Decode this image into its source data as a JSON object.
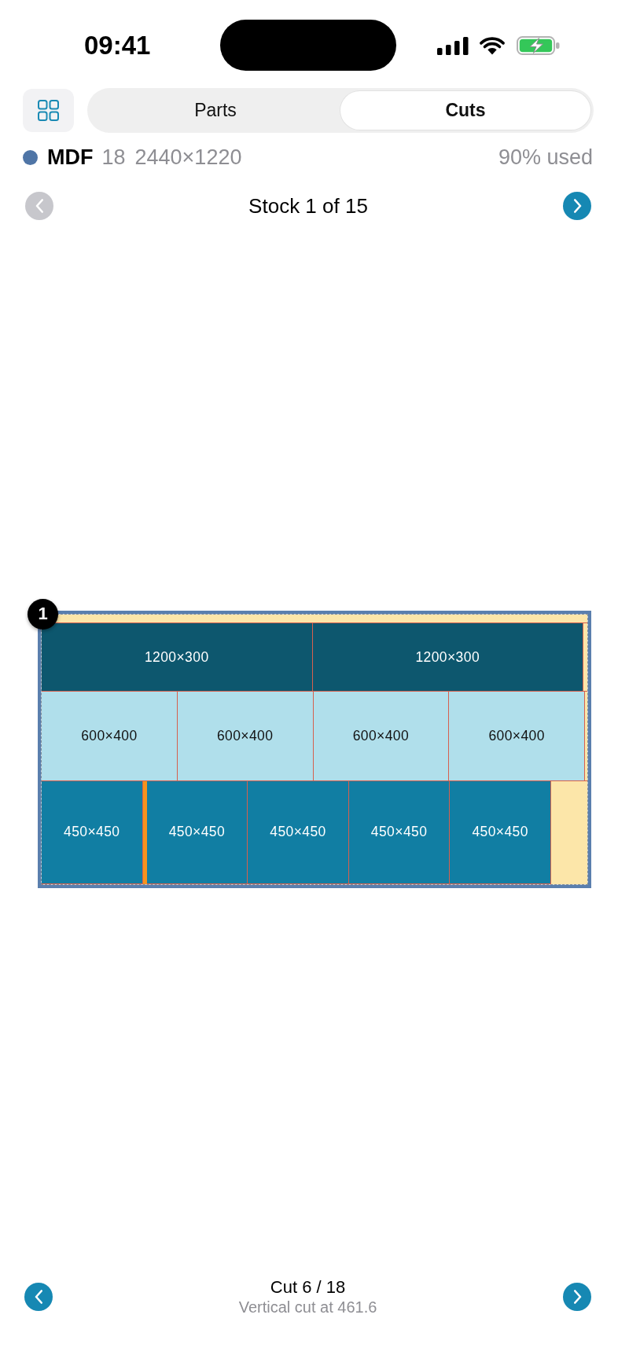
{
  "status_bar": {
    "time": "09:41"
  },
  "toolbar": {
    "tabs": [
      {
        "label": "Parts",
        "selected": false
      },
      {
        "label": "Cuts",
        "selected": true
      }
    ]
  },
  "material": {
    "color": "#4f75a6",
    "name": "MDF",
    "thickness": "18",
    "size": "2440×1220",
    "usage": "90% used"
  },
  "stock_nav": {
    "label": "Stock 1 of 15",
    "prev": {
      "disabled": true
    },
    "next": {
      "disabled": false
    }
  },
  "sheet": {
    "badge": "1",
    "rows": [
      {
        "items": [
          {
            "kind": "offcut",
            "cut_after": false
          }
        ]
      },
      {
        "items": [
          {
            "kind": "dark",
            "label": "1200×300",
            "cut_after": false
          },
          {
            "kind": "dark",
            "label": "1200×300",
            "cut_after": false
          },
          {
            "kind": "offcut",
            "cut_after": false
          }
        ]
      },
      {
        "items": [
          {
            "kind": "light",
            "label": "600×400",
            "cut_after": false
          },
          {
            "kind": "light",
            "label": "600×400",
            "cut_after": false
          },
          {
            "kind": "light",
            "label": "600×400",
            "cut_after": false
          },
          {
            "kind": "light",
            "label": "600×400",
            "cut_after": false
          },
          {
            "kind": "offcut",
            "cut_after": false
          }
        ]
      },
      {
        "items": [
          {
            "kind": "medium",
            "label": "450×450",
            "cut_after": true
          },
          {
            "kind": "medium",
            "label": "450×450",
            "cut_after": false
          },
          {
            "kind": "medium",
            "label": "450×450",
            "cut_after": false
          },
          {
            "kind": "medium",
            "label": "450×450",
            "cut_after": false
          },
          {
            "kind": "medium",
            "label": "450×450",
            "cut_after": false
          },
          {
            "kind": "offcut",
            "cut_after": false
          }
        ]
      }
    ]
  },
  "cut_nav": {
    "title": "Cut 6 / 18",
    "description": "Vertical cut at 461.6",
    "prev": {
      "disabled": false
    },
    "next": {
      "disabled": false
    }
  }
}
